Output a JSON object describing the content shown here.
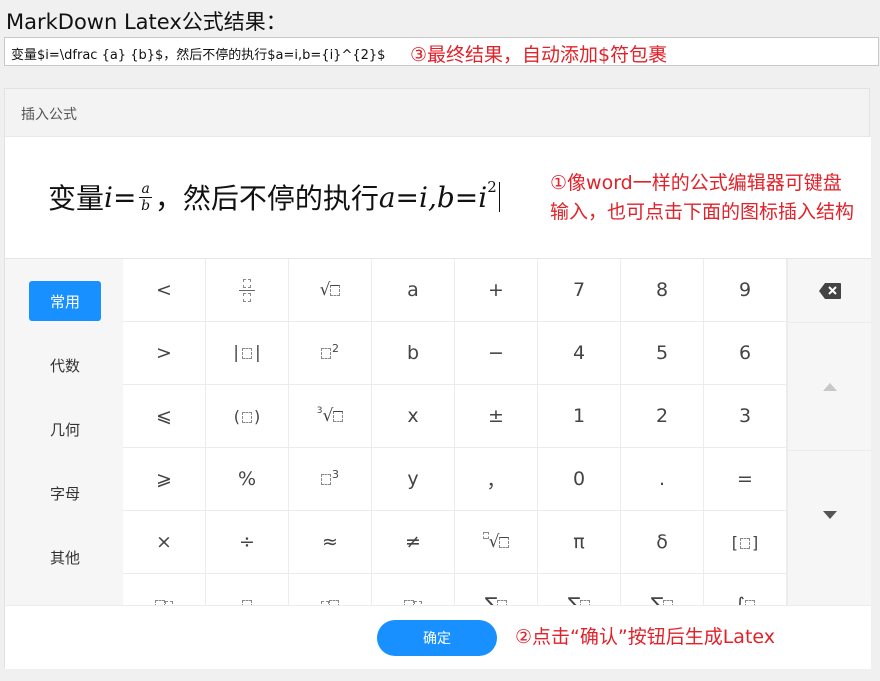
{
  "heading": "MarkDown Latex公式结果：",
  "result": {
    "value": "变量$i=\\dfrac {a} {b}$，然后不停的执行$a=i,b={i}^{2}$",
    "note": "③最终结果，自动添加$符包裹"
  },
  "dialog": {
    "title": "插入公式",
    "formula": {
      "part1": "变量",
      "var_i": "i",
      "eq": "=",
      "frac_num": "a",
      "frac_den": "b",
      "part2": "，然后不停的执行",
      "expr": "a=i,b=i",
      "sup": "2"
    },
    "note1": "①像word一样的公式编辑器可键盘输入，也可点击下面的图标插入结构",
    "categories": [
      "常用",
      "代数",
      "几何",
      "字母",
      "其他"
    ],
    "keys": {
      "r1": [
        "<",
        "",
        "",
        "a",
        "+",
        "7",
        "8",
        "9"
      ],
      "r2": [
        ">",
        "",
        "",
        "b",
        "−",
        "4",
        "5",
        "6"
      ],
      "r3": [
        "⩽",
        "",
        "",
        "x",
        "±",
        "1",
        "2",
        "3"
      ],
      "r4": [
        "⩾",
        "%",
        "",
        "y",
        "，",
        "0",
        ".",
        "="
      ],
      "r5": [
        "×",
        "÷",
        "≈",
        "≠",
        "",
        "π",
        "δ",
        ""
      ],
      "r6": [
        "",
        "",
        "",
        "",
        "∑",
        "∑",
        "∑",
        "∫"
      ]
    },
    "superscripts": {
      "square": "2",
      "cube": "3",
      "cbrt_index": "3"
    },
    "side_icons": [
      "backspace-icon",
      "arrow-up-icon",
      "arrow-down-icon"
    ],
    "ok_label": "确定",
    "note2": "②点击“确认”按钮后生成Latex"
  },
  "colors": {
    "accent": "#1890ff",
    "annotation": "#e0222a"
  }
}
